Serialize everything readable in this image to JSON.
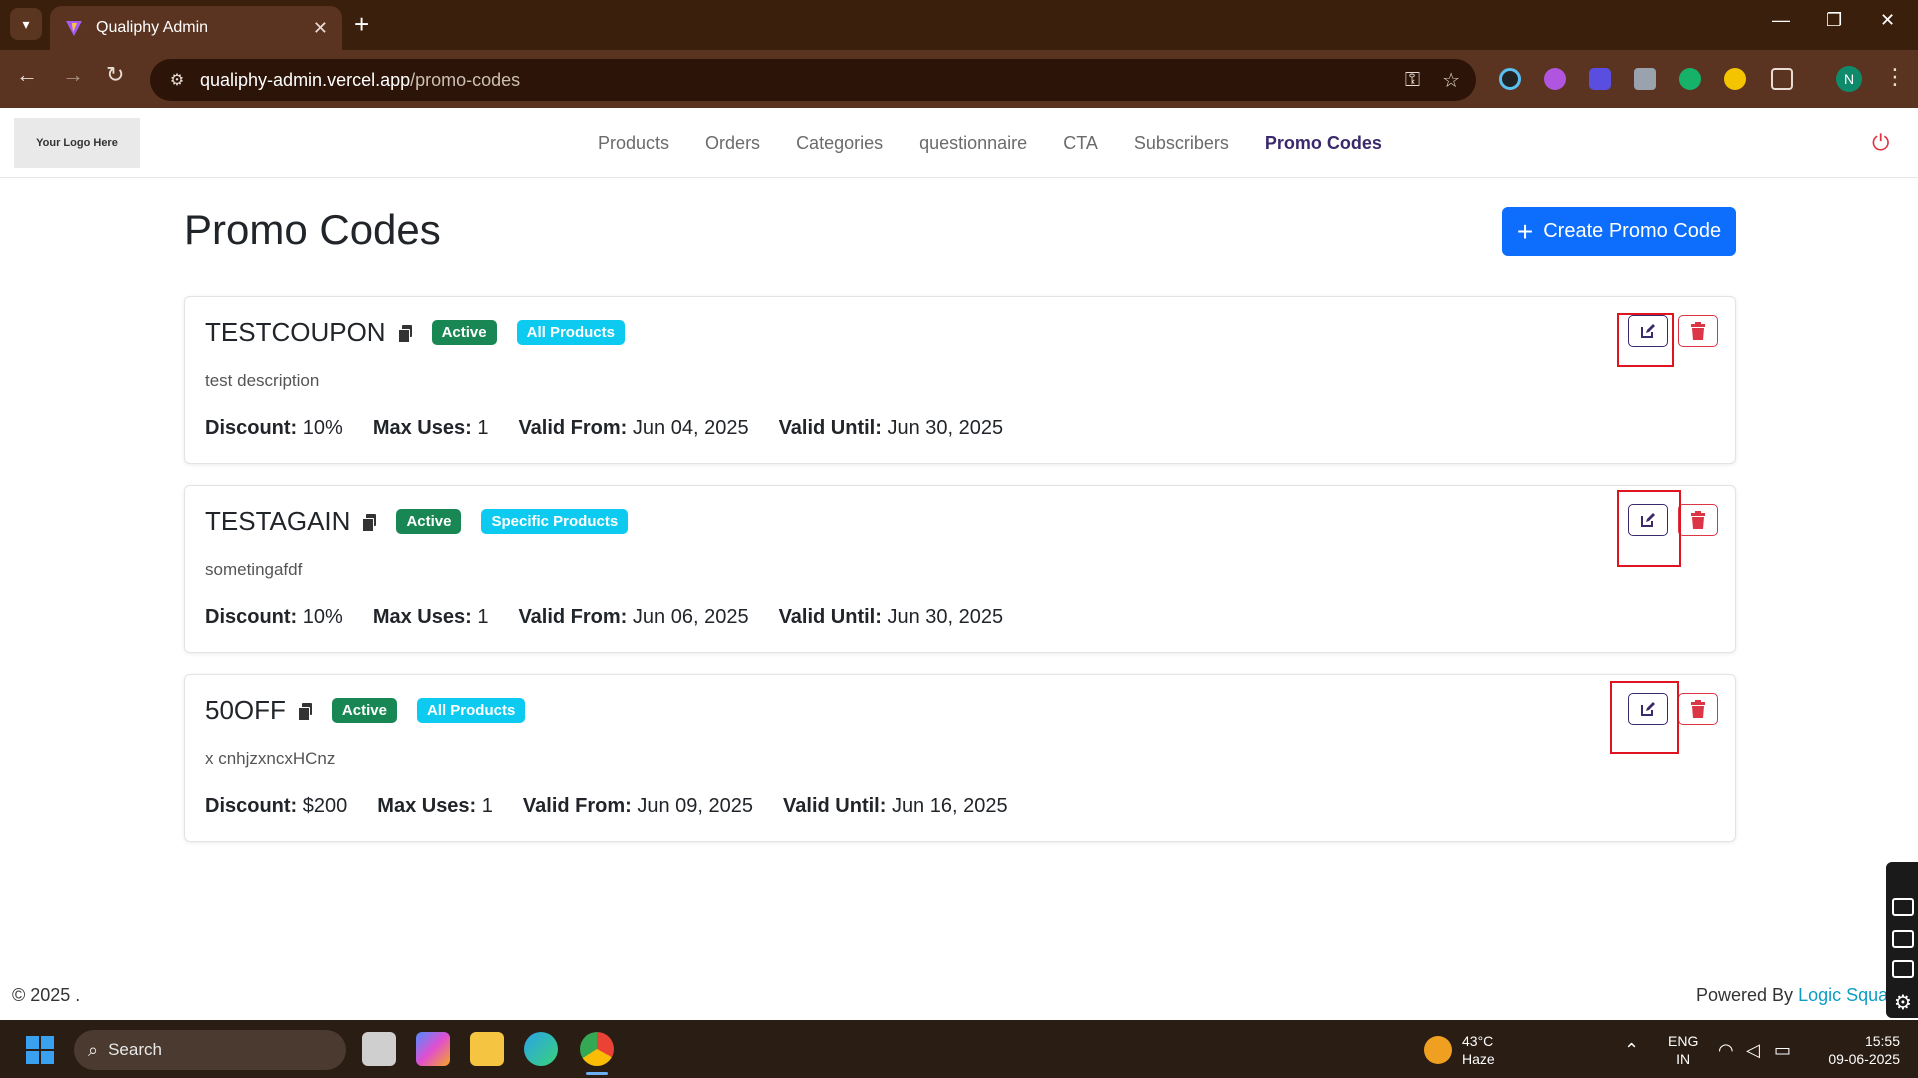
{
  "browser": {
    "tab_title": "Qualiphy Admin",
    "url_domain": "qualiphy-admin.vercel.app",
    "url_path": "/promo-codes",
    "profile_initial": "N"
  },
  "header": {
    "logo_text": "Your Logo Here",
    "nav": [
      {
        "label": "Products"
      },
      {
        "label": "Orders"
      },
      {
        "label": "Categories"
      },
      {
        "label": "questionnaire"
      },
      {
        "label": "CTA"
      },
      {
        "label": "Subscribers"
      },
      {
        "label": "Promo Codes",
        "active": true
      }
    ]
  },
  "page": {
    "title": "Promo Codes",
    "create_button_label": "Create Promo Code"
  },
  "labels": {
    "discount": "Discount:",
    "max_uses": "Max Uses:",
    "valid_from": "Valid From:",
    "valid_until": "Valid Until:"
  },
  "promo_codes": [
    {
      "code": "TESTCOUPON",
      "status": "Active",
      "scope": "All Products",
      "description": "test description",
      "discount": "10%",
      "max_uses": "1",
      "valid_from": "Jun 04, 2025",
      "valid_until": "Jun 30, 2025"
    },
    {
      "code": "TESTAGAIN",
      "status": "Active",
      "scope": "Specific Products",
      "description": "sometingafdf",
      "discount": "10%",
      "max_uses": "1",
      "valid_from": "Jun 06, 2025",
      "valid_until": "Jun 30, 2025"
    },
    {
      "code": "50OFF",
      "status": "Active",
      "scope": "All Products",
      "description": "x cnhjzxncxHCnz",
      "discount": "$200",
      "max_uses": "1",
      "valid_from": "Jun 09, 2025",
      "valid_until": "Jun 16, 2025"
    }
  ],
  "footer": {
    "copyright": "© 2025 .",
    "powered_by": "Powered By",
    "powered_link": "Logic Squa"
  },
  "taskbar": {
    "search_placeholder": "Search",
    "temperature": "43°C",
    "weather": "Haze",
    "language": "ENG",
    "region": "IN",
    "time": "15:55",
    "date": "09-06-2025"
  },
  "colors": {
    "primary": "#0d6efd",
    "success": "#198754",
    "info": "#0dcaf0",
    "danger": "#dc3545",
    "nav_active": "#3b2a6b"
  }
}
